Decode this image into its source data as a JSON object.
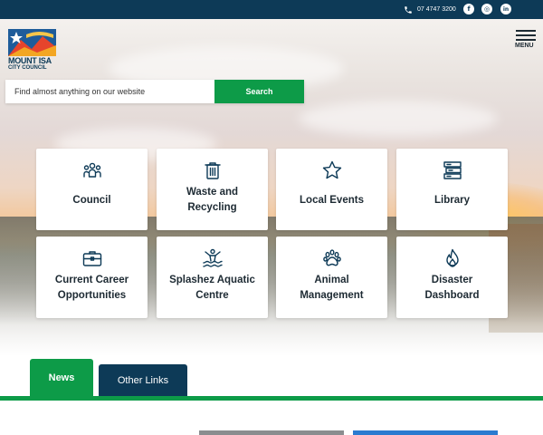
{
  "topbar": {
    "phone": "07 4747 3200",
    "social": [
      {
        "name": "facebook-icon",
        "glyph": "f"
      },
      {
        "name": "instagram-icon",
        "glyph": "◎"
      },
      {
        "name": "linkedin-icon",
        "glyph": "in"
      }
    ]
  },
  "logo": {
    "line1": "MOUNT ISA",
    "line2": "CITY COUNCIL"
  },
  "menu": {
    "label": "MENU"
  },
  "search": {
    "placeholder": "Find almost anything on our website",
    "button_label": "Search"
  },
  "tiles": [
    {
      "label": "Council",
      "icon": "people-icon"
    },
    {
      "label": "Waste and\nRecycling",
      "icon": "bin-icon"
    },
    {
      "label": "Local Events",
      "icon": "star-icon"
    },
    {
      "label": "Library",
      "icon": "books-icon"
    },
    {
      "label": "Current Career\nOpportunities",
      "icon": "briefcase-icon"
    },
    {
      "label": "Splashez Aquatic\nCentre",
      "icon": "swimmer-icon"
    },
    {
      "label": "Animal\nManagement",
      "icon": "paw-icon"
    },
    {
      "label": "Disaster\nDashboard",
      "icon": "flame-icon"
    }
  ],
  "tabs": {
    "news": "News",
    "other": "Other Links"
  },
  "colors": {
    "navy": "#0d3a57",
    "green": "#0d9b48"
  }
}
